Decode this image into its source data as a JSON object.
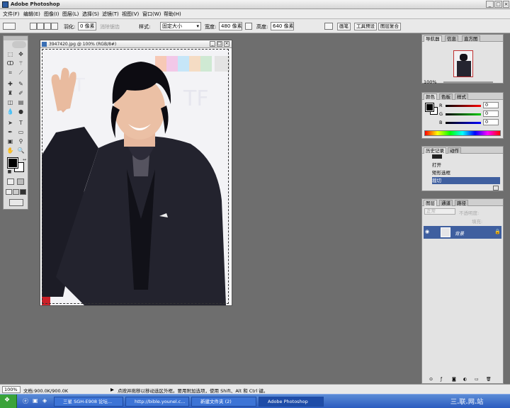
{
  "app": {
    "title": "Adobe Photoshop"
  },
  "menu": [
    "文件(F)",
    "编辑(E)",
    "图像(I)",
    "图层(L)",
    "选择(S)",
    "滤镜(T)",
    "视图(V)",
    "窗口(W)",
    "帮助(H)"
  ],
  "options": {
    "feather_label": "羽化:",
    "feather_value": "0 像素",
    "antialias_label": "消除锯齿",
    "style_label": "样式:",
    "style_value": "固定大小",
    "width_label": "宽度:",
    "width_value": "480 像素",
    "height_label": "高度:",
    "height_value": "640 像素",
    "dock_tabs": [
      "画笔",
      "工具预设",
      "图层复合"
    ]
  },
  "document": {
    "title": "3947420.jpg @ 100% (RGB/8#)"
  },
  "navigator": {
    "tabs": [
      "导航器",
      "信息",
      "直方图"
    ],
    "zoom": "100%"
  },
  "color_panel": {
    "tabs": [
      "颜色",
      "色板",
      "样式"
    ],
    "channels": [
      {
        "label": "R",
        "value": "0"
      },
      {
        "label": "G",
        "value": "0"
      },
      {
        "label": "B",
        "value": "0"
      }
    ]
  },
  "history": {
    "tabs": [
      "历史记录",
      "动作"
    ],
    "items": [
      "打开",
      "矩形选框",
      "裁切"
    ]
  },
  "layers": {
    "tabs": [
      "图层",
      "通道",
      "路径"
    ],
    "layer_name": "背景",
    "blend_mode": "正常",
    "opacity_label": "不透明度:",
    "fill_label": "填充:"
  },
  "status": {
    "zoom": "100%",
    "doc_info": "文档:900.0K/900.0K",
    "hint": "点按并拖移以移动选区外框。要用附加选项，使用 Shift、Alt 和 Ctrl 键。"
  },
  "taskbar": {
    "items": [
      "三星 SGH-E908 论坛...",
      "http://bible.younel.c...",
      "新建文件夹 (2)",
      "Adobe Photoshop"
    ],
    "watermark": "三.联.网.站"
  },
  "colors": {
    "accent": "#2b5bbf",
    "selected": "#3f5f9f"
  }
}
